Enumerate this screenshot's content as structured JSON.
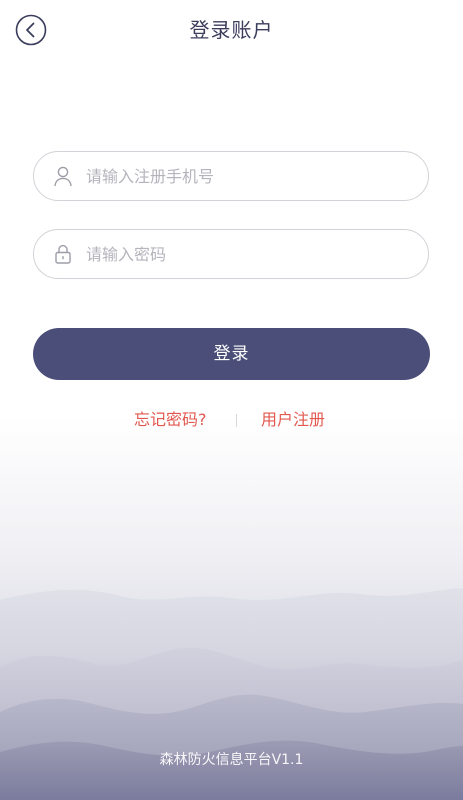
{
  "header": {
    "title": "登录账户",
    "back_icon": "chevron-left-icon"
  },
  "form": {
    "phone": {
      "placeholder": "请输入注册手机号",
      "value": "",
      "icon": "user-icon"
    },
    "password": {
      "placeholder": "请输入密码",
      "value": "",
      "icon": "lock-icon"
    },
    "submit_label": "登录"
  },
  "links": {
    "forgot_password": "忘记密码?",
    "register": "用户注册"
  },
  "footer": {
    "app_name_version": "森林防火信息平台V1.1"
  },
  "colors": {
    "primary_button": "#4a4e78",
    "link": "#e2584f",
    "title": "#3b3d5c",
    "placeholder": "#b4b4bc",
    "field_border": "#d2d2d8"
  }
}
